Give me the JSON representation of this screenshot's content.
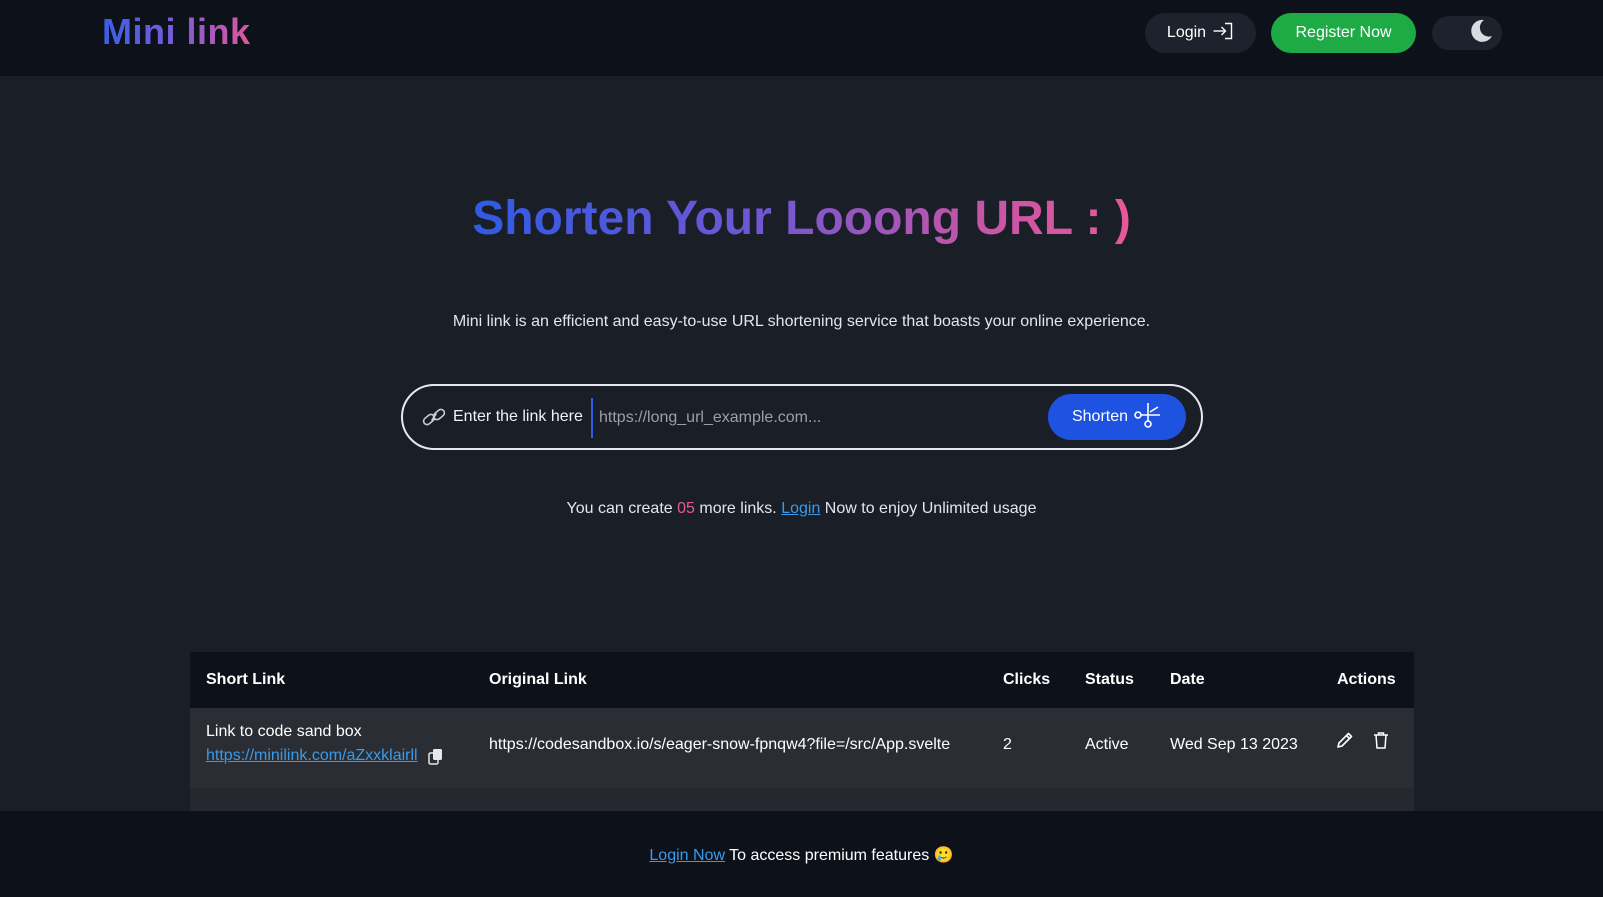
{
  "header": {
    "logo": "Mini link",
    "login_label": "Login",
    "register_label": "Register Now"
  },
  "hero": {
    "title": "Shorten Your Looong URL : )",
    "subtitle": "Mini link is an efficient and easy-to-use URL shortening service that boasts your online experience."
  },
  "shortener": {
    "label": "Enter the link here",
    "placeholder": "https://long_url_example.com...",
    "button_label": "Shorten"
  },
  "quota": {
    "prefix": "You can create",
    "count": "05",
    "middle": "more links.",
    "login_link": "Login",
    "suffix": "Now to enjoy Unlimited usage"
  },
  "table": {
    "headers": [
      "Short Link",
      "Original Link",
      "Clicks",
      "Status",
      "Date",
      "Actions"
    ],
    "rows": [
      {
        "name": "Link to code sand box",
        "short_url": "https://minilink.com/aZxxklairll",
        "original_url": "https://codesandbox.io/s/eager-snow-fpnqw4?file=/src/App.svelte",
        "clicks": "2",
        "status": "Active",
        "date": "Wed Sep 13 2023"
      }
    ]
  },
  "footer": {
    "login_link": "Login Now",
    "text": "To access premium features 🥲"
  },
  "icons": {
    "login": "login-arrow-icon",
    "theme": "moon-icon",
    "link": "link-icon",
    "shorten": "scissors-icon",
    "copy": "copy-icon",
    "edit": "pencil-icon",
    "delete": "trash-icon"
  },
  "colors": {
    "background": "#1a1e27",
    "header": "#0d111a",
    "accent_blue": "#1d53e0",
    "register_green": "#1eab45",
    "link_blue": "#3a9ae8",
    "count_pink": "#e8579a"
  }
}
